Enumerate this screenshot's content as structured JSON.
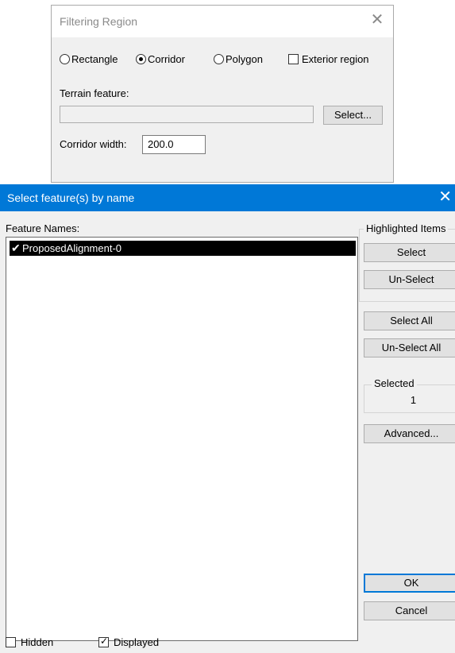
{
  "filtering_region": {
    "title": "Filtering Region",
    "close_glyph": "✕",
    "options": {
      "rectangle": {
        "label": "Rectangle",
        "checked": false
      },
      "corridor": {
        "label": "Corridor",
        "checked": true
      },
      "polygon": {
        "label": "Polygon",
        "checked": false
      },
      "exterior_region": {
        "label": "Exterior region",
        "checked": false
      }
    },
    "terrain_feature_label": "Terrain feature:",
    "terrain_feature_value": "",
    "select_button": "Select...",
    "corridor_width_label": "Corridor width:",
    "corridor_width_value": "200.0"
  },
  "select_features": {
    "title": "Select feature(s) by name",
    "close_glyph": "✕",
    "feature_names_label": "Feature Names:",
    "items": [
      {
        "name": "ProposedAlignment-0",
        "check_glyph": "✔",
        "selected": true
      }
    ],
    "highlighted_items": {
      "label": "Highlighted Items",
      "select": "Select",
      "unselect": "Un-Select"
    },
    "select_all": "Select All",
    "unselect_all": "Un-Select All",
    "selected_group": {
      "label": "Selected",
      "count": "1"
    },
    "advanced": "Advanced...",
    "ok": "OK",
    "cancel": "Cancel",
    "hidden": {
      "label": "Hidden",
      "checked": false
    },
    "displayed": {
      "label": "Displayed",
      "checked": true,
      "tick": "✓"
    }
  },
  "colors": {
    "titlebar_active": "#0078d7",
    "dialog_bg": "#f0f0f0",
    "selection_bg": "#000000"
  },
  "icons": [
    "close-icon",
    "check-icon",
    "radio-icon",
    "checkbox-icon"
  ]
}
